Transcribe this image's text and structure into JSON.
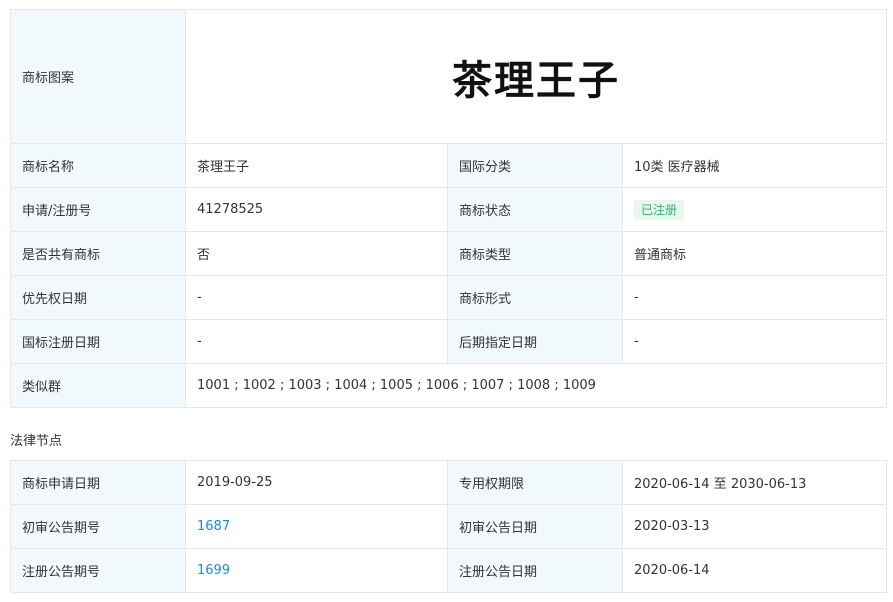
{
  "info": {
    "pattern_label": "商标图案",
    "logo_text": "茶理王子",
    "name_label": "商标名称",
    "name_value": "茶理王子",
    "class_label": "国际分类",
    "class_value": "10类 医疗器械",
    "regno_label": "申请/注册号",
    "regno_value": "41278525",
    "status_label": "商标状态",
    "status_value": "已注册",
    "shared_label": "是否共有商标",
    "shared_value": "否",
    "type_label": "商标类型",
    "type_value": "普通商标",
    "priority_label": "优先权日期",
    "priority_value": "-",
    "form_label": "商标形式",
    "form_value": "-",
    "intl_label": "国标注册日期",
    "intl_value": "-",
    "later_label": "后期指定日期",
    "later_value": "-",
    "similar_label": "类似群",
    "similar_value": "1001 ; 1002 ; 1003 ; 1004 ; 1005 ; 1006 ; 1007 ; 1008 ; 1009"
  },
  "legal": {
    "section_title": "法律节点",
    "apply_date_label": "商标申请日期",
    "apply_date_value": "2019-09-25",
    "exclusive_label": "专用权期限",
    "exclusive_value": "2020-06-14 至 2030-06-13",
    "prelim_no_label": "初审公告期号",
    "prelim_no_value": "1687",
    "prelim_date_label": "初审公告日期",
    "prelim_date_value": "2020-03-13",
    "reg_no_label": "注册公告期号",
    "reg_no_value": "1699",
    "reg_date_label": "注册公告日期",
    "reg_date_value": "2020-06-14"
  },
  "colors": {
    "label_bg": "#f2f9fc",
    "border": "#e4e8ee",
    "link": "#1e88e5",
    "status_green": "#2eb46e"
  }
}
